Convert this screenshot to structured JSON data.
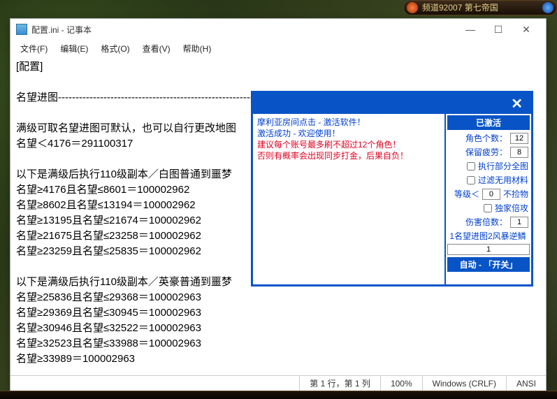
{
  "game_header": {
    "text": "频道92007 第七帝国"
  },
  "notepad": {
    "title": "配置.ini - 记事本",
    "menus": [
      "文件(F)",
      "编辑(E)",
      "格式(O)",
      "查看(V)",
      "帮助(H)"
    ],
    "content": "[配置]\n\n名望进图--------------------------------------------------------------------------------------------\n\n满级可取名望进图可默认，也可以自行更改地图\n名望＜4176＝291100317\n\n以下是满级后执行110级副本／白图普通到噩梦\n名望≥4176且名望≤8601＝100002962\n名望≥8602且名望≤13194＝100002962\n名望≥13195且名望≤21674＝100002962\n名望≥21675且名望≤23258＝100002962\n名望≥23259且名望≤25835＝100002962\n\n以下是满级后执行110级副本／英豪普通到噩梦\n名望≥25836且名望≤29368＝100002963\n名望≥29369且名望≤30945＝100002963\n名望≥30946且名望≤32522＝100002963\n名望≥32523且名望≤33988＝100002963\n名望≥33989＝100002963\n\n如名望达到可进英豪则未开英豪地图时请把英豪地图的编号改为白图编号开图后再改回来即可。",
    "status": {
      "pos": "第 1 行，第 1 列",
      "zoom": "100%",
      "eol": "Windows (CRLF)",
      "enc": "ANSI"
    }
  },
  "overlay": {
    "msg1": "摩利亚房间点击 - 激活软件！",
    "msg2": "激活成功 - 欢迎使用！",
    "msg3": "建议每个账号最多刷不超过12个角色！",
    "msg4": "否则有概率会出现同步打金，后果自负！",
    "badge": "已激活",
    "rows": {
      "role_count_label": "角色个数：",
      "role_count_value": "12",
      "keep_fatigue_label": "保留疲劳：",
      "keep_fatigue_value": "8",
      "exec_partial_label": "执行部分全图",
      "filter_useless_label": "过滤无用材料",
      "level_lt_label": "等级＜",
      "level_lt_value": "0",
      "no_pickup_label": "不捡物",
      "exclusive_label": "独家倍攻",
      "dmg_mult_label": "伤害倍数：",
      "dmg_mult_value": "1",
      "mode_label": "1名望进图2风暴逆鳞",
      "mode_value": "1"
    },
    "footer": "自动 - 「开关」"
  }
}
